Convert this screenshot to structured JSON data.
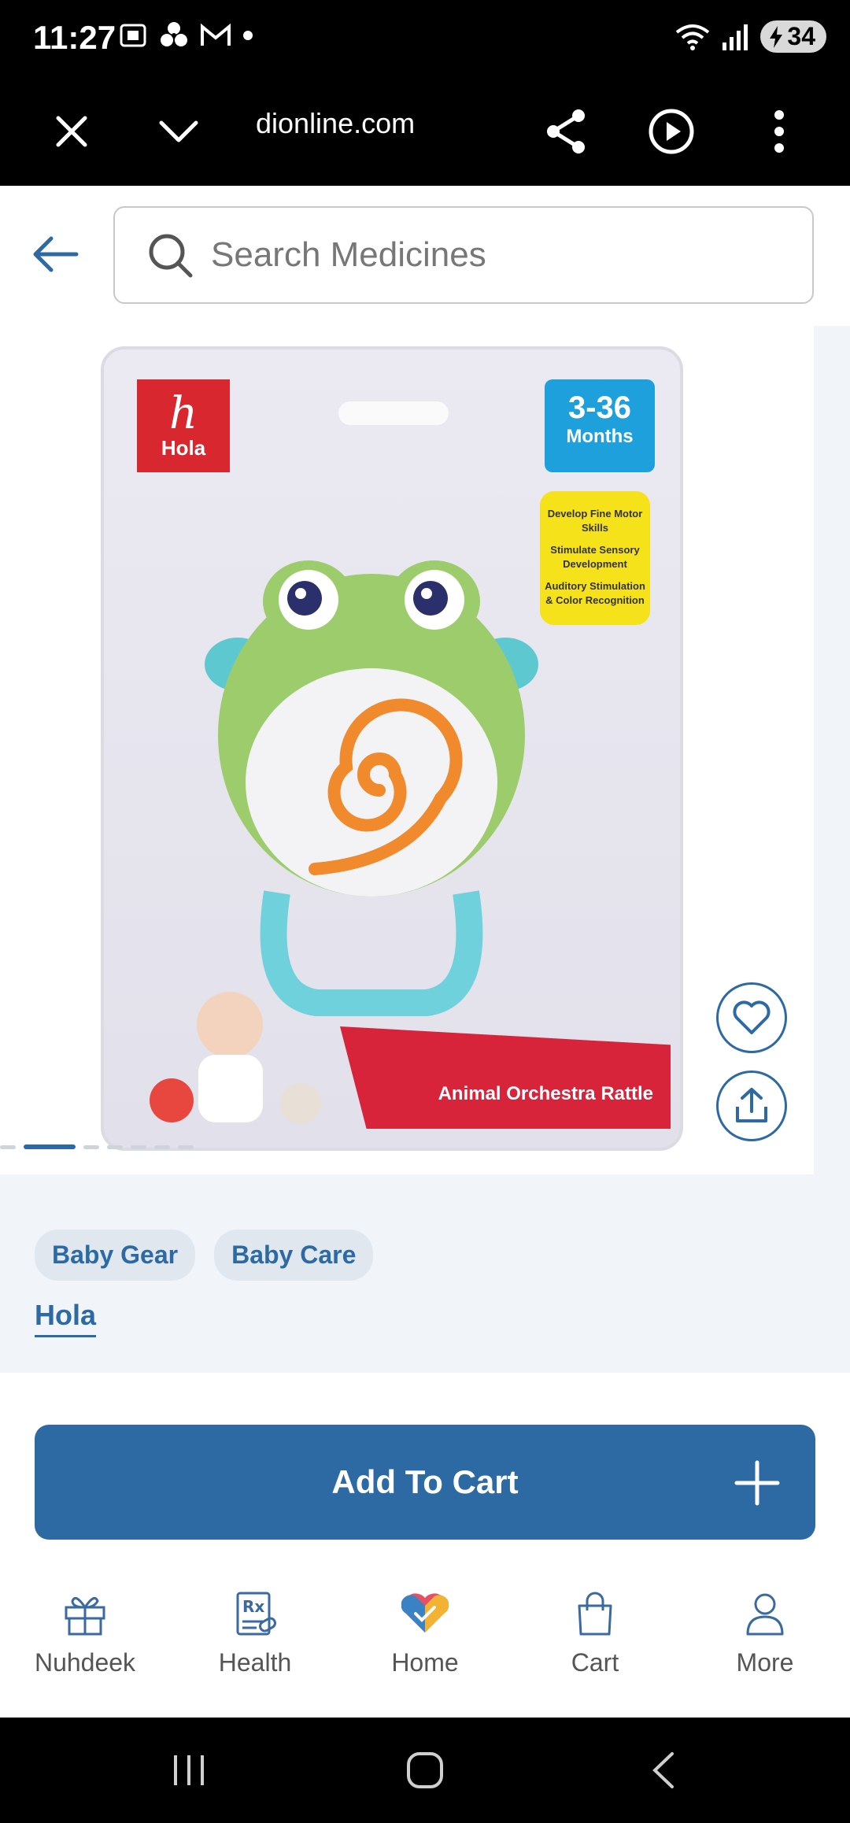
{
  "status_bar": {
    "time": "11:27",
    "battery": "34",
    "icons": [
      "screenshot-icon",
      "fan-icon",
      "gmail-icon",
      "dot-icon",
      "wifi-icon",
      "signal-icon",
      "battery-icon"
    ]
  },
  "browser": {
    "url": "dionline.com",
    "icons": [
      "close-icon",
      "chevron-down-icon",
      "share-icon",
      "play-icon",
      "more-vertical-icon"
    ]
  },
  "header": {
    "search_placeholder": "Search Medicines"
  },
  "product_image": {
    "brand_logo_text": "Hola",
    "age_range": "3-36",
    "age_unit": "Months",
    "features": [
      "Develop Fine Motor Skills",
      "Stimulate Sensory Development",
      "Auditory Stimulation & Color Recognition"
    ],
    "product_name_on_pack": "Animal Orchestra Rattle",
    "slide_count": 7,
    "active_slide": 1
  },
  "categories": [
    "Baby Gear",
    "Baby Care"
  ],
  "brand_link": "Hola",
  "add_to_cart": {
    "label": "Add To Cart"
  },
  "bottom_nav": [
    {
      "label": "Nuhdeek",
      "icon": "gift-icon"
    },
    {
      "label": "Health",
      "icon": "prescription-icon"
    },
    {
      "label": "Home",
      "icon": "home-heart-icon"
    },
    {
      "label": "Cart",
      "icon": "shopping-bag-icon"
    },
    {
      "label": "More",
      "icon": "user-icon"
    }
  ],
  "colors": {
    "primary": "#2d6aa4",
    "chip_bg": "#e0e7ef",
    "page_bg": "#f1f5f9",
    "brand_red": "#d8272f"
  }
}
